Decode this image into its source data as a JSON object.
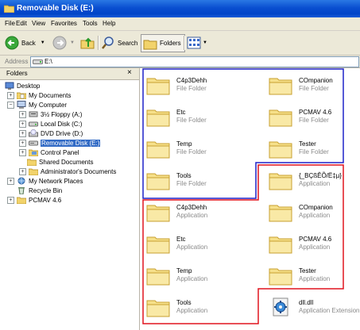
{
  "window": {
    "title": "Removable Disk (E:)"
  },
  "menu": [
    "File",
    "Edit",
    "View",
    "Favorites",
    "Tools",
    "Help"
  ],
  "toolbar": {
    "back": "Back",
    "search": "Search",
    "folders": "Folders"
  },
  "address": {
    "label": "Address",
    "value": "E:\\"
  },
  "folders_pane": {
    "title": "Folders",
    "close": "×",
    "tree": [
      {
        "label": "Desktop"
      },
      {
        "label": "My Documents"
      },
      {
        "label": "My Computer"
      },
      {
        "label": "3½ Floppy (A:)"
      },
      {
        "label": "Local Disk (C:)"
      },
      {
        "label": "DVD Drive (D:)"
      },
      {
        "label": "Removable Disk (E:)"
      },
      {
        "label": "Control Panel"
      },
      {
        "label": "Shared Documents"
      },
      {
        "label": "Administrator's Documents"
      },
      {
        "label": "My Network Places"
      },
      {
        "label": "Recycle Bin"
      },
      {
        "label": "PCMAV 4.6"
      }
    ]
  },
  "files": [
    {
      "name": "C4p3Dehh",
      "type": "File Folder"
    },
    {
      "name": "COmpanion",
      "type": "File Folder"
    },
    {
      "name": "Etc",
      "type": "File Folder"
    },
    {
      "name": "PCMAV 4.6",
      "type": "File Folder"
    },
    {
      "name": "Temp",
      "type": "File Folder"
    },
    {
      "name": "Tester",
      "type": "File Folder"
    },
    {
      "name": "Tools",
      "type": "File Folder"
    },
    {
      "name": "{_BÇßÊÕ/Ë‡µ}",
      "type": "Application"
    },
    {
      "name": "C4p3Dehh",
      "type": "Application"
    },
    {
      "name": "COmpanion",
      "type": "Application"
    },
    {
      "name": "Etc",
      "type": "Application"
    },
    {
      "name": "PCMAV 4.6",
      "type": "Application"
    },
    {
      "name": "Temp",
      "type": "Application"
    },
    {
      "name": "Tester",
      "type": "Application"
    },
    {
      "name": "Tools",
      "type": "Application"
    },
    {
      "name": "dll.dll",
      "type": "Application Extension"
    }
  ],
  "colors": {
    "title_bar": "#0a4fd0",
    "selection": "#316ac5",
    "folder_group_outline": "#1e22c8",
    "application_group_outline": "#e0141e"
  }
}
